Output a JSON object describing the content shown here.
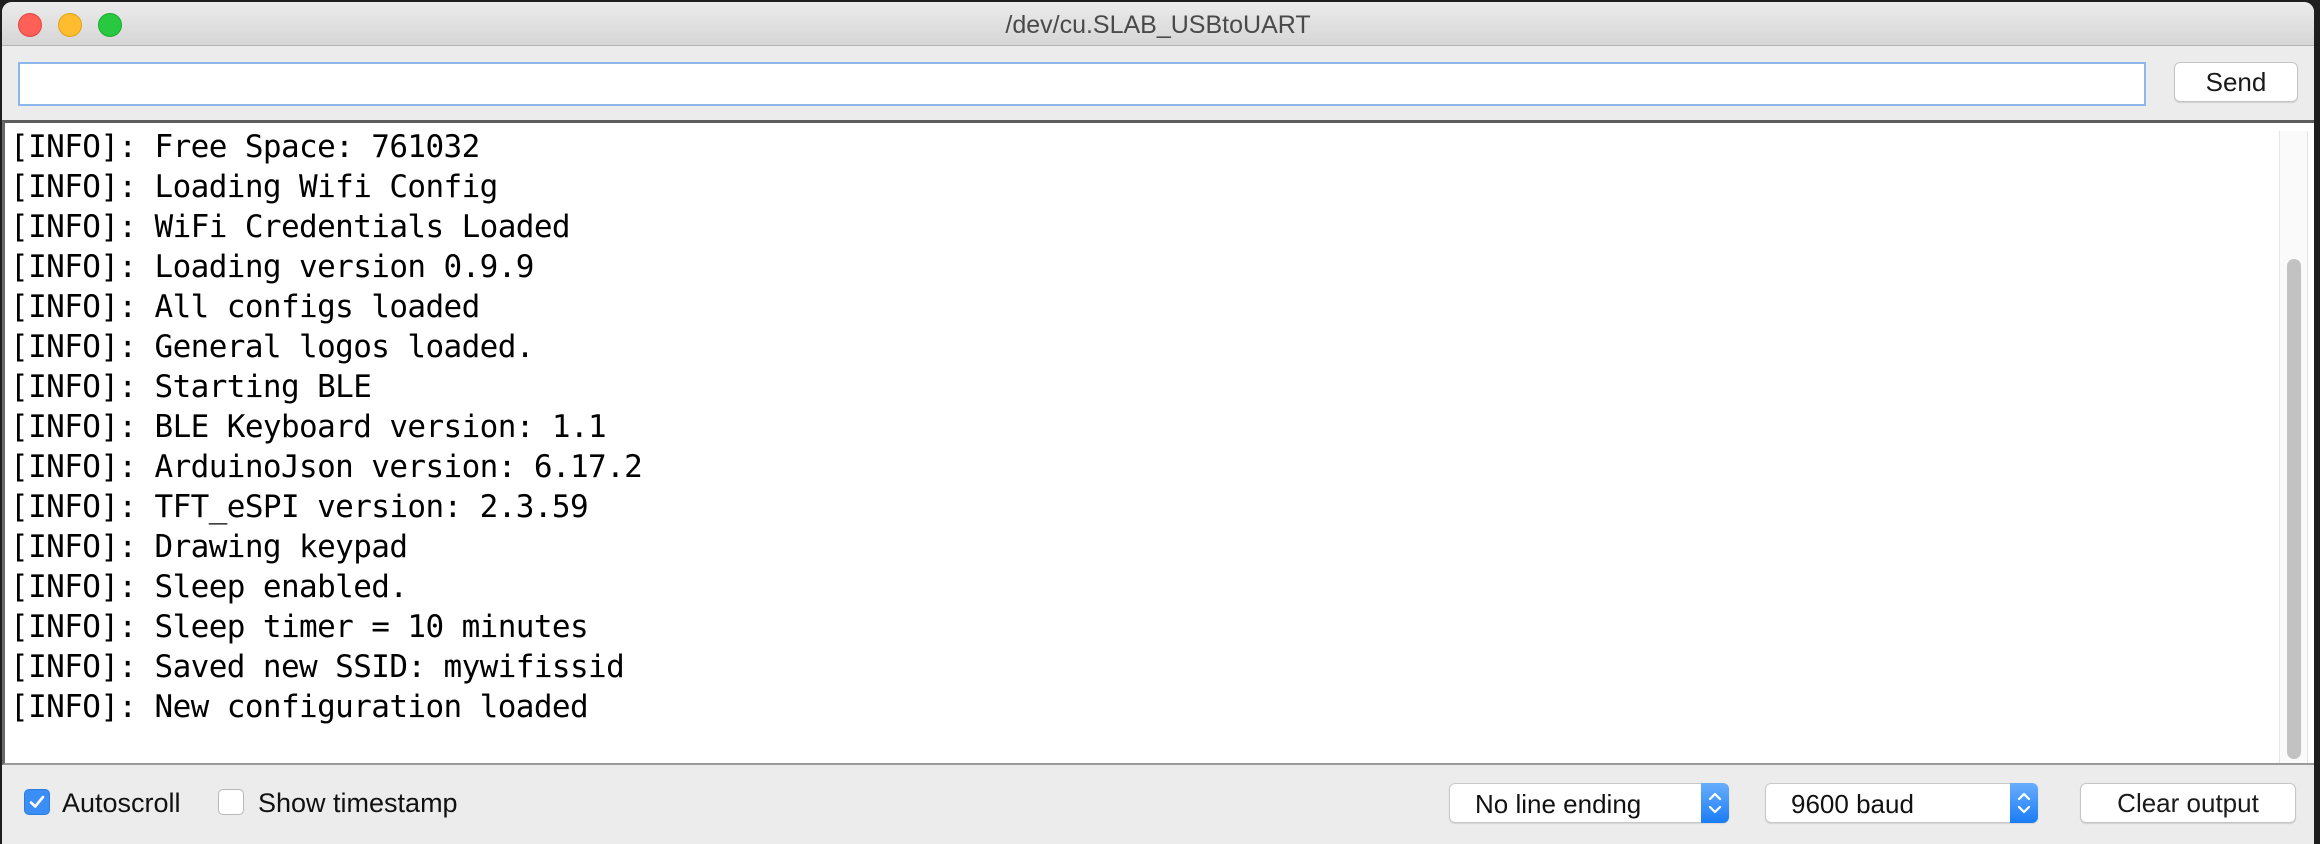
{
  "window": {
    "title": "/dev/cu.SLAB_USBtoUART"
  },
  "send_bar": {
    "input_value": "",
    "input_placeholder": "",
    "send_label": "Send"
  },
  "output": {
    "lines": [
      "[INFO]: Free Space: 761032",
      "[INFO]: Loading Wifi Config",
      "[INFO]: WiFi Credentials Loaded",
      "[INFO]: Loading version 0.9.9",
      "[INFO]: All configs loaded",
      "[INFO]: General logos loaded.",
      "[INFO]: Starting BLE",
      "[INFO]: BLE Keyboard version: 1.1",
      "[INFO]: ArduinoJson version: 6.17.2",
      "[INFO]: TFT_eSPI version: 2.3.59",
      "[INFO]: Drawing keypad",
      "[INFO]: Sleep enabled.",
      "[INFO]: Sleep timer = 10 minutes",
      "[INFO]: Saved new SSID: mywifissid",
      "[INFO]: New configuration loaded"
    ]
  },
  "footer": {
    "autoscroll": {
      "label": "Autoscroll",
      "checked": true
    },
    "show_timestamp": {
      "label": "Show timestamp",
      "checked": false
    },
    "line_ending": {
      "selected": "No line ending"
    },
    "baud_rate": {
      "selected": "9600 baud"
    },
    "clear_label": "Clear output"
  },
  "colors": {
    "accent": "#3a8ef5",
    "close": "#fe5f57",
    "minimize": "#febc2e",
    "maximize": "#28c840"
  }
}
